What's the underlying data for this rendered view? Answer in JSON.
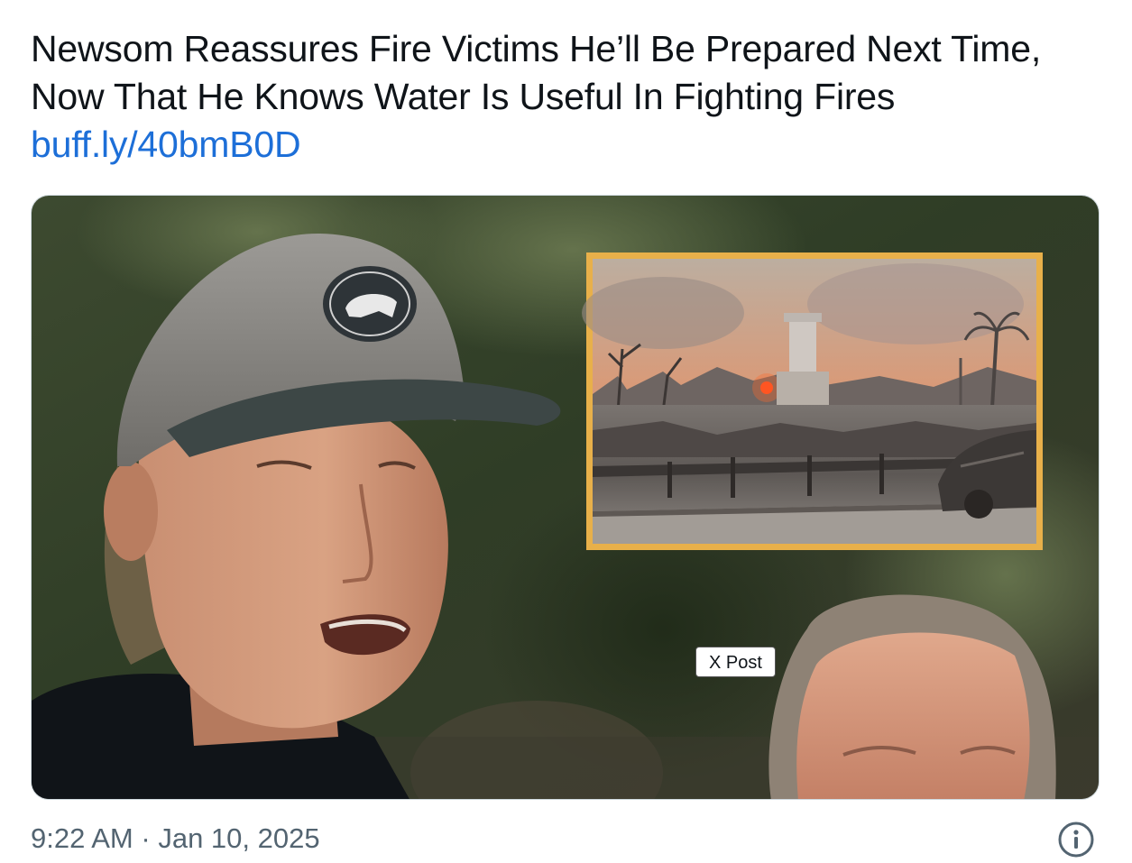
{
  "post": {
    "headline": "Newsom Reassures Fire Victims He’ll Be Prepared Next Time, Now That He Knows Water Is Useful In Fighting Fires",
    "link": "buff.ly/40bmB0D"
  },
  "media": {
    "badge": "X Post",
    "inset_frame_color": "#e8b04a"
  },
  "meta": {
    "time": "9:22 AM",
    "separator": "·",
    "date": "Jan 10, 2025"
  },
  "icons": {
    "info": "info-circle-icon"
  }
}
